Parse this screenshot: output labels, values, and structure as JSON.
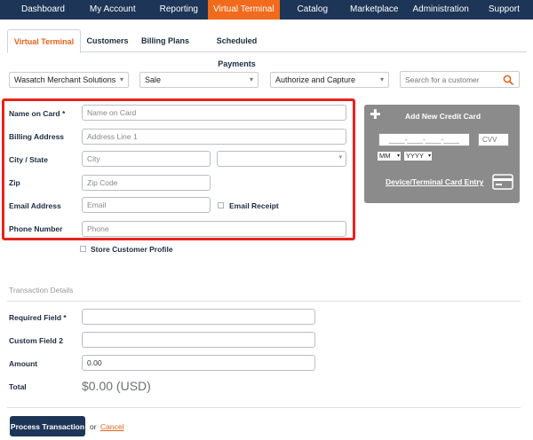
{
  "nav": {
    "items": [
      {
        "label": "Dashboard",
        "active": false
      },
      {
        "label": "My Account",
        "active": false
      },
      {
        "label": "Reporting",
        "active": false
      },
      {
        "label": "Virtual Terminal",
        "active": true
      },
      {
        "label": "Catalog",
        "active": false
      },
      {
        "label": "Marketplace",
        "active": false
      },
      {
        "label": "Administration",
        "active": false
      },
      {
        "label": "Support",
        "active": false
      }
    ],
    "active_color": "#f26a1b",
    "bar_color": "#1d3557"
  },
  "tabs": [
    {
      "label": "Virtual Terminal",
      "active": true
    },
    {
      "label": "Customers",
      "active": false
    },
    {
      "label": "Billing Plans",
      "active": false
    },
    {
      "label": "Scheduled Payments",
      "active": false
    }
  ],
  "toolbar": {
    "merchant": "Wasatch Merchant Solutions",
    "transaction_type": "Sale",
    "mode": "Authorize and Capture",
    "search_placeholder": "Search for a customer"
  },
  "form": {
    "name_label": "Name on Card *",
    "name_placeholder": "Name on Card",
    "address_label": "Billing Address",
    "address_placeholder": "Address Line 1",
    "city_label": "City / State",
    "city_placeholder": "City",
    "zip_label": "Zip",
    "zip_placeholder": "Zip Code",
    "email_label": "Email Address",
    "email_placeholder": "Email",
    "email_receipt_label": "Email Receipt",
    "phone_label": "Phone Number",
    "phone_placeholder": "Phone",
    "store_profile_label": "Store Customer Profile"
  },
  "card": {
    "title": "Add New Credit Card",
    "number_placeholder": "____-____-____-____",
    "cvv_placeholder": "CVV",
    "month": "MM",
    "year": "YYYY",
    "device_link": "Device/Terminal Card Entry"
  },
  "transaction": {
    "section_title": "Transaction Details",
    "required_label": "Required Field *",
    "custom_label": "Custom Field 2",
    "amount_label": "Amount",
    "amount_value": "0.00",
    "total_label": "Total",
    "total_value": "$0.00 (USD)"
  },
  "actions": {
    "process_label": "Process Transaction",
    "or_text": "or",
    "cancel_label": "Cancel"
  },
  "colors": {
    "highlight": "#e8231b",
    "accent": "#e8621a",
    "card_panel": "#8b8b8b"
  }
}
